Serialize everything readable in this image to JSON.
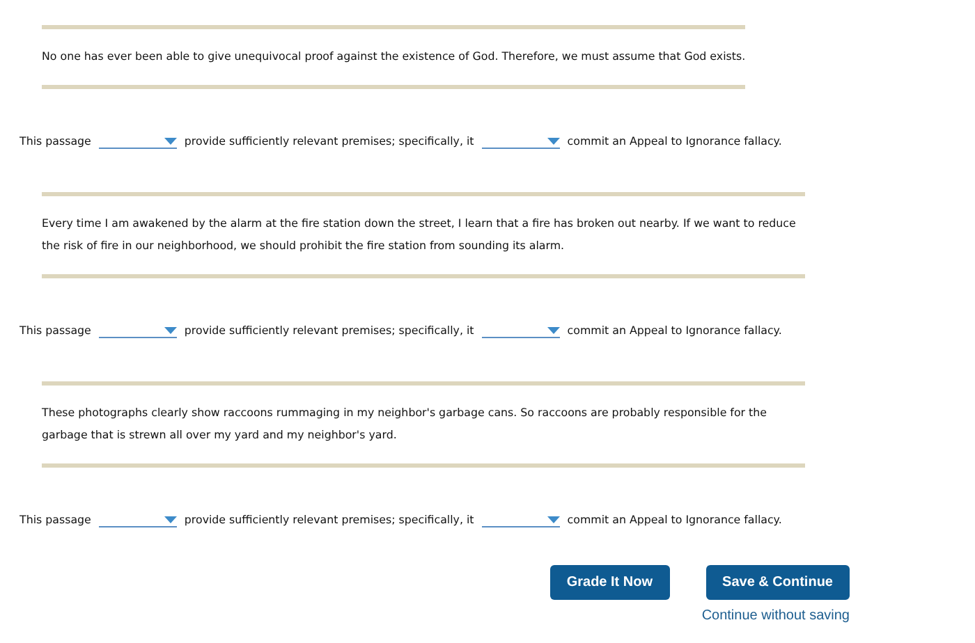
{
  "questions": [
    {
      "passage": "No one has ever been able to give unequivocal proof against the existence of God. Therefore, we must assume that God exists.",
      "parts": [
        {
          "kind": "text",
          "text": "This passage"
        },
        {
          "kind": "dropdown"
        },
        {
          "kind": "text",
          "text": "provide sufficiently relevant premises; specifically, it"
        },
        {
          "kind": "dropdown"
        },
        {
          "kind": "text",
          "text": "commit an Appeal to Ignorance fallacy."
        }
      ]
    },
    {
      "passage": "Every time I am awakened by the alarm at the fire station down the street, I learn that a fire has broken out nearby. If we want to reduce the risk of fire in our neighborhood, we should prohibit the fire station from sounding its alarm.",
      "parts": [
        {
          "kind": "text",
          "text": "This passage"
        },
        {
          "kind": "dropdown"
        },
        {
          "kind": "text",
          "text": "provide sufficiently relevant premises; specifically, it"
        },
        {
          "kind": "dropdown"
        },
        {
          "kind": "text",
          "text": "commit an Appeal to Ignorance fallacy."
        }
      ]
    },
    {
      "passage": "These photographs clearly show raccoons rummaging in my neighbor's garbage cans. So raccoons are probably responsible for the garbage that is strewn all over my yard and my neighbor's yard.",
      "parts": [
        {
          "kind": "text",
          "text": "This passage"
        },
        {
          "kind": "dropdown"
        },
        {
          "kind": "text",
          "text": "provide sufficiently relevant premises; specifically, it"
        },
        {
          "kind": "dropdown"
        },
        {
          "kind": "text",
          "text": "commit an Appeal to Ignorance fallacy."
        }
      ]
    }
  ],
  "buttons": [
    "Grade It Now",
    "Save & Continue"
  ],
  "link": "Continue without saving"
}
